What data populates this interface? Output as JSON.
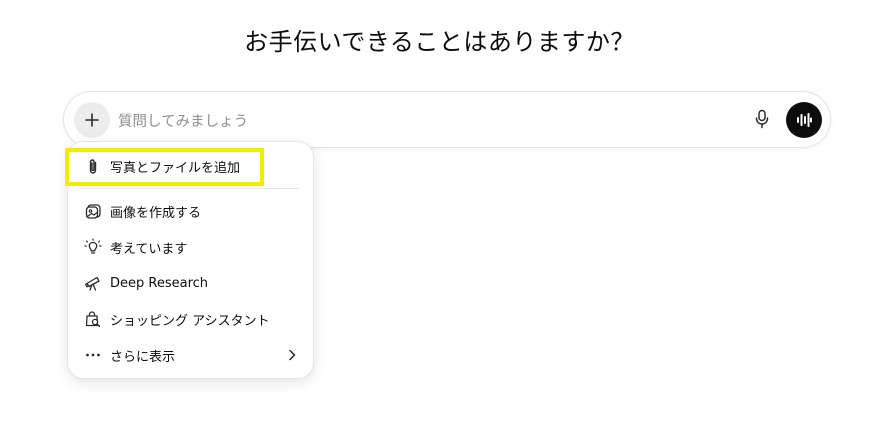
{
  "heading": "お手伝いできることはありますか？",
  "composer": {
    "placeholder": "質問してみましょう",
    "add_icon": "plus-icon",
    "mic_icon": "microphone-icon",
    "voice_icon": "voice-waveform-icon"
  },
  "menu": {
    "items": [
      {
        "label": "写真とファイルを追加",
        "icon": "paperclip-icon"
      },
      {
        "label": "画像を作成する",
        "icon": "image-create-icon"
      },
      {
        "label": "考えています",
        "icon": "lightbulb-icon"
      },
      {
        "label": "Deep Research",
        "icon": "telescope-icon"
      },
      {
        "label": "ショッピング アシスタント",
        "icon": "shopping-bag-search-icon"
      },
      {
        "label": "さらに表示",
        "icon": "more-dots-icon",
        "chevron": "chevron-right-icon"
      }
    ]
  },
  "colors": {
    "highlight": "#f2ec00",
    "voice_button": "#0d0d0d",
    "plus_button_bg": "#ececec"
  }
}
